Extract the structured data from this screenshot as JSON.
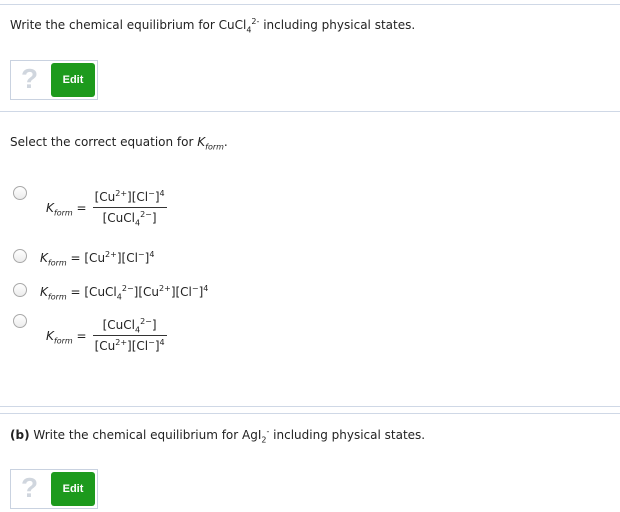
{
  "part_a": {
    "question_prefix": "Write the chemical equilibrium for CuCl",
    "question_sub": "4",
    "question_sup": "2-",
    "question_suffix": " including physical states.",
    "help_symbol": "?",
    "edit_label": "Edit",
    "select_prefix": "Select the correct equation for ",
    "select_k": "K",
    "select_ksub": "form",
    "select_suffix": "."
  },
  "options": [
    {
      "lhs_k": "K",
      "lhs_sub": "form",
      "eq": "=",
      "num": "[Cu2+][Cl−]4",
      "den": "[CuCl42−]"
    },
    {
      "lhs_k": "K",
      "lhs_sub": "form",
      "eq": "=",
      "expr": "[Cu2+][Cl−]4"
    },
    {
      "lhs_k": "K",
      "lhs_sub": "form",
      "eq": "=",
      "expr": "[CuCl42−][Cu2+][Cl−]4"
    },
    {
      "lhs_k": "K",
      "lhs_sub": "form",
      "eq": "=",
      "num": "[CuCl42−]",
      "den": "[Cu2+][Cl−]4"
    }
  ],
  "part_b": {
    "label": "(b)",
    "question_prefix": " Write the chemical equilibrium for AgI",
    "question_sub": "2",
    "question_sup": "-",
    "question_suffix": " including physical states.",
    "help_symbol": "?",
    "edit_label": "Edit"
  }
}
